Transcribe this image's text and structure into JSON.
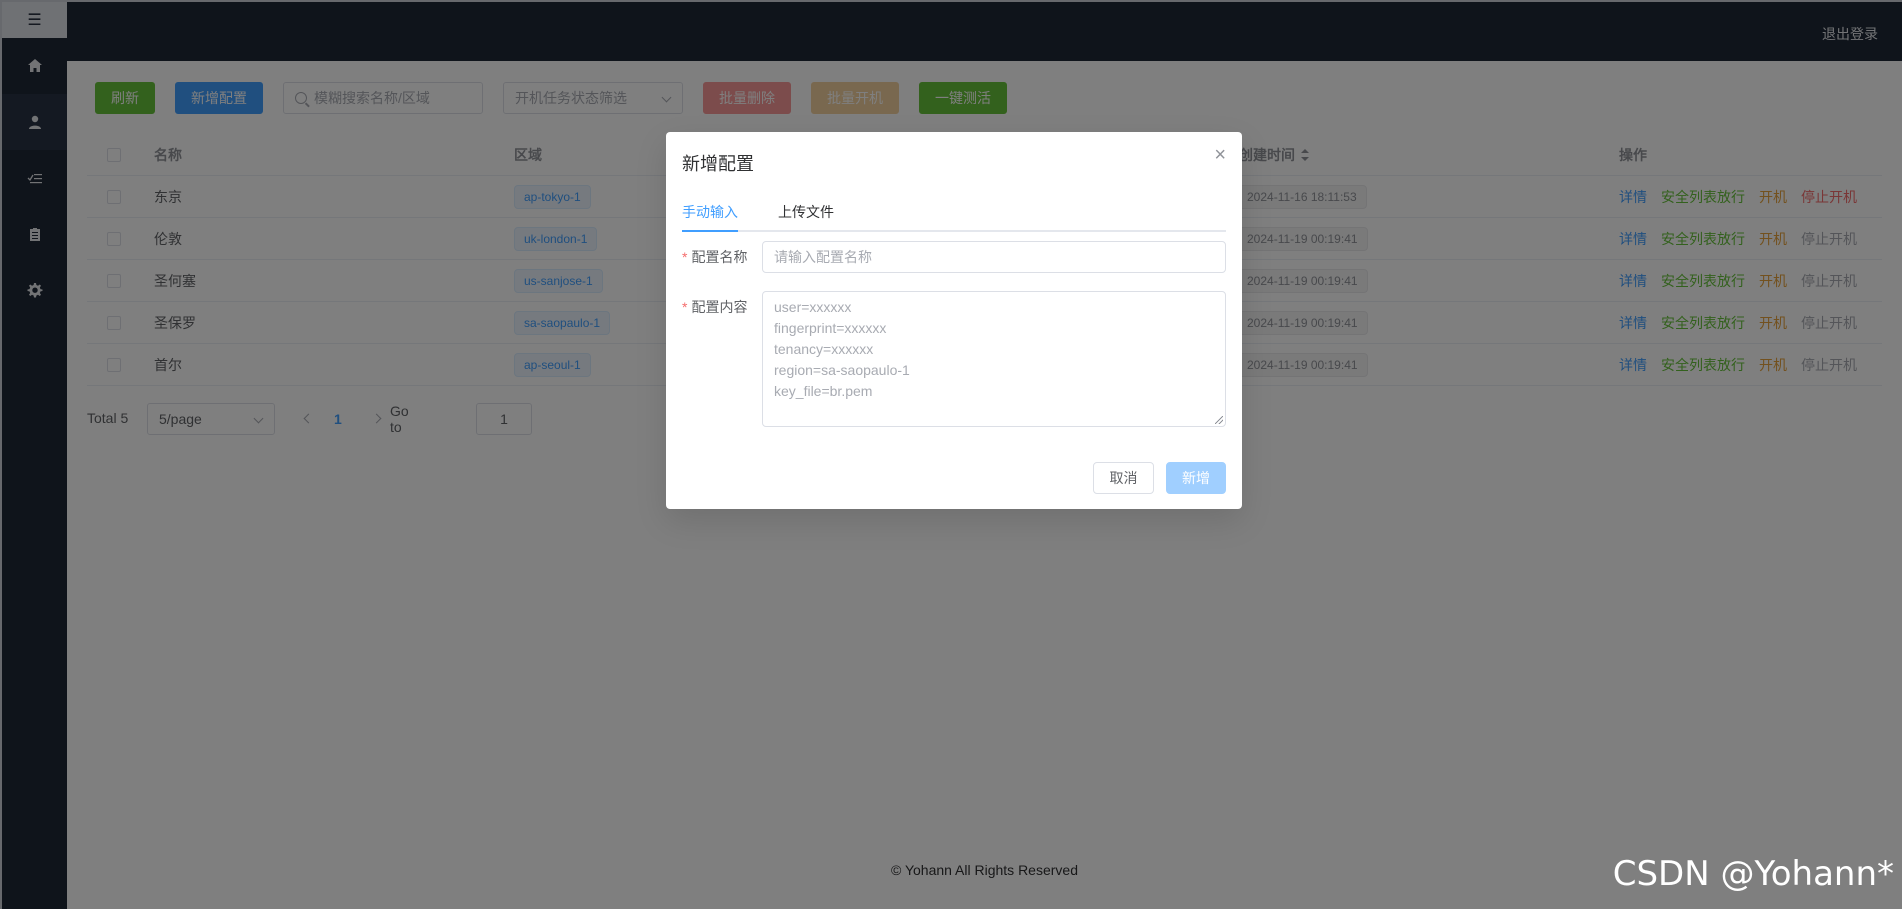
{
  "header": {
    "logout_label": "退出登录"
  },
  "sidebar": {
    "toggle_icon": "☰",
    "items": [
      {
        "name": "home",
        "icon": "home-icon",
        "active": false
      },
      {
        "name": "user",
        "icon": "user-icon",
        "active": true
      },
      {
        "name": "checklist",
        "icon": "checklist-icon",
        "active": false
      },
      {
        "name": "clipboard",
        "icon": "clipboard-icon",
        "active": false
      },
      {
        "name": "settings",
        "icon": "gear-icon",
        "active": false
      }
    ]
  },
  "toolbar": {
    "refresh_label": "刷新",
    "add_label": "新增配置",
    "search_placeholder": "模糊搜索名称/区域",
    "status_filter_placeholder": "开机任务状态筛选",
    "batch_delete_label": "批量删除",
    "batch_start_label": "批量开机",
    "test_all_label": "一键测活"
  },
  "table": {
    "headers": {
      "name": "名称",
      "region": "区域",
      "created": "创建时间",
      "actions": "操作"
    },
    "rows": [
      {
        "name": "东京",
        "region": "ap-tokyo-1",
        "created": "2024-11-16 18:11:53",
        "stop_enabled": true
      },
      {
        "name": "伦敦",
        "region": "uk-london-1",
        "created": "2024-11-19 00:19:41",
        "stop_enabled": false
      },
      {
        "name": "圣何塞",
        "region": "us-sanjose-1",
        "created": "2024-11-19 00:19:41",
        "stop_enabled": false
      },
      {
        "name": "圣保罗",
        "region": "sa-saopaulo-1",
        "created": "2024-11-19 00:19:41",
        "stop_enabled": false
      },
      {
        "name": "首尔",
        "region": "ap-seoul-1",
        "created": "2024-11-19 00:19:41",
        "stop_enabled": false
      }
    ],
    "actions": {
      "detail": "详情",
      "allow": "安全列表放行",
      "start": "开机",
      "stop": "停止开机"
    }
  },
  "pagination": {
    "total_label": "Total 5",
    "page_size": "5/page",
    "current_page": "1",
    "goto_label": "Go to",
    "goto_value": "1"
  },
  "footer": {
    "text": "© Yohann All Rights Reserved"
  },
  "dialog": {
    "title": "新增配置",
    "close_icon": "×",
    "tabs": {
      "manual": "手动输入",
      "upload": "上传文件"
    },
    "name_label": "配置名称",
    "name_placeholder": "请输入配置名称",
    "content_label": "配置内容",
    "content_placeholder": "user=xxxxxx\nfingerprint=xxxxxx\ntenancy=xxxxxx\nregion=sa-saopaulo-1\nkey_file=br.pem",
    "cancel_label": "取消",
    "submit_label": "新增"
  },
  "watermark": "CSDN @Yohann*",
  "colors": {
    "primary": "#409eff",
    "success": "#67c23a",
    "warning": "#e6a23c",
    "danger": "#f56c6c",
    "sidebar_bg": "#1f2937"
  }
}
